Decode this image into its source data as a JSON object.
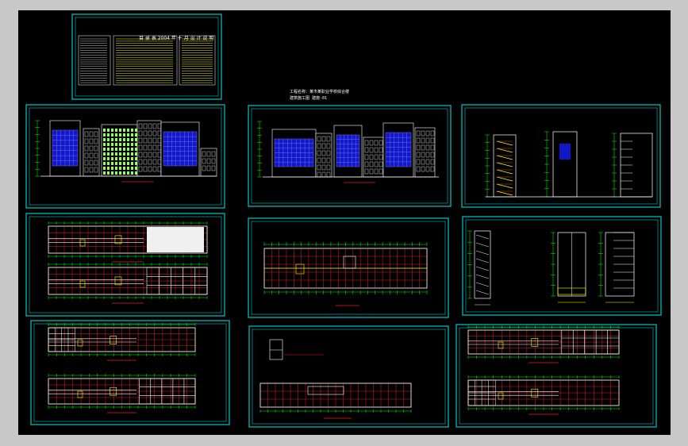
{
  "app": {
    "background_color": "#000000",
    "frame_color": "#00c8c8",
    "grid_color": "#e02020",
    "wall_color": "#ffffff",
    "dim_color": "#00ff00",
    "accent_yellow": "#ffff00",
    "glass_blue": "#1018c8"
  },
  "sheets": [
    {
      "name": "cover-index",
      "title": "目 录 表 2004 年 十 月 设 计 说 明"
    },
    {
      "name": "elevation-south"
    },
    {
      "name": "elevation-north",
      "caption_line1": "工程名称：某市某职业学校综合楼",
      "caption_line2": "建筑施工图  建施-01"
    },
    {
      "name": "elevation-sections"
    },
    {
      "name": "plan-floors-1-2"
    },
    {
      "name": "plan-site"
    },
    {
      "name": "section-stairs"
    },
    {
      "name": "plan-floors-3-4"
    },
    {
      "name": "plan-roof"
    },
    {
      "name": "plan-floors-5-6"
    }
  ]
}
